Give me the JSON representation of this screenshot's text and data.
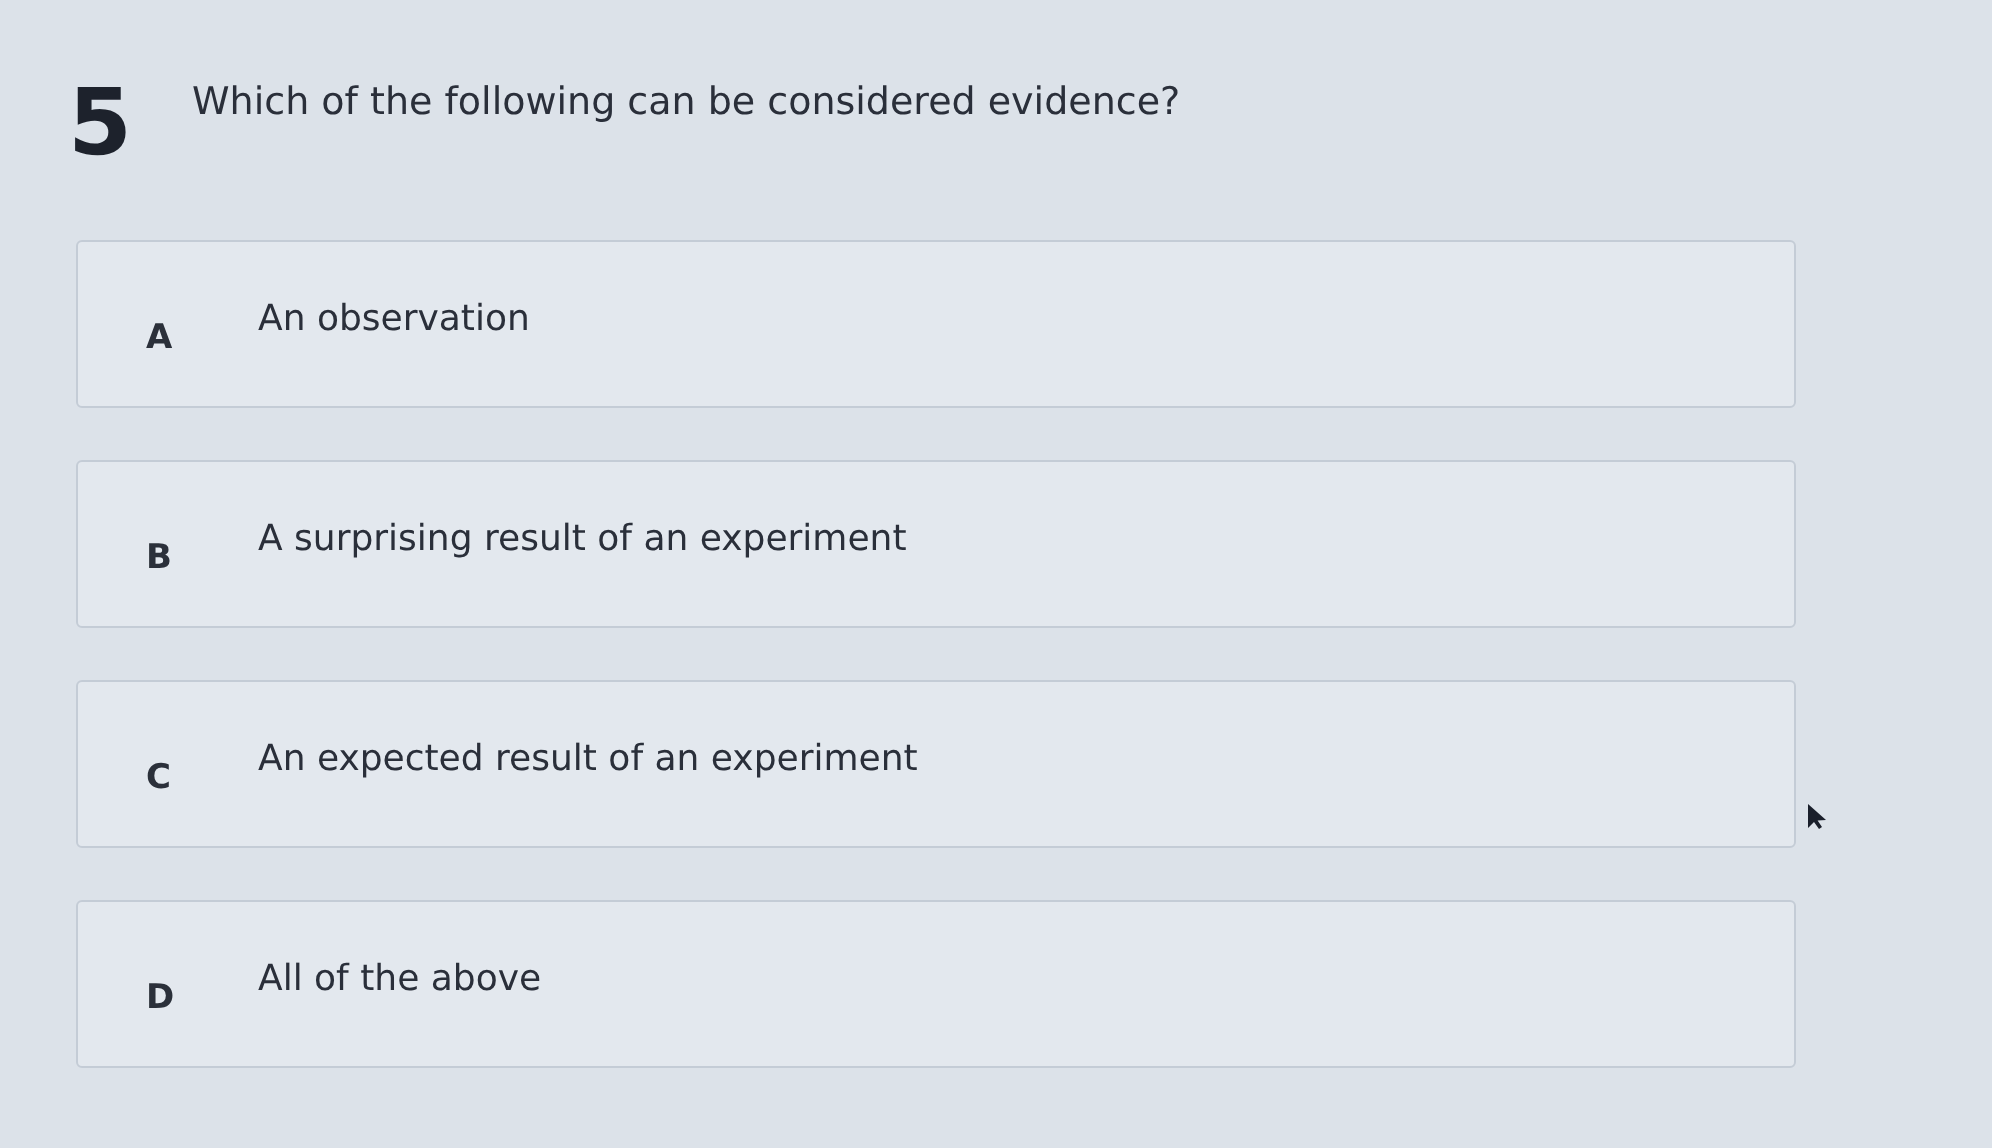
{
  "question": {
    "number": "5",
    "text": "Which of the following can be considered evidence?"
  },
  "options": [
    {
      "letter": "A",
      "text": "An observation"
    },
    {
      "letter": "B",
      "text": "A surprising result of an experiment"
    },
    {
      "letter": "C",
      "text": "An expected result of an experiment"
    },
    {
      "letter": "D",
      "text": "All of the above"
    }
  ]
}
